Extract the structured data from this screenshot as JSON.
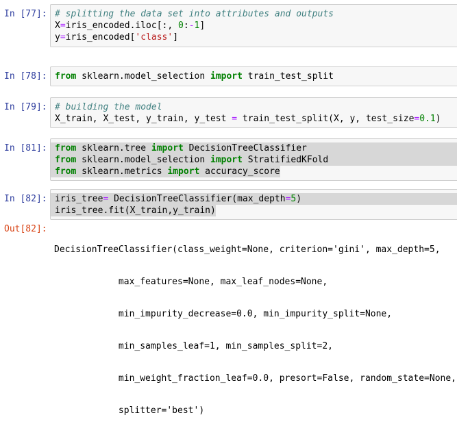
{
  "cells": [
    {
      "prompt": "In [77]:",
      "lines": [
        [
          {
            "t": "# splitting the data set into attributes and outputs",
            "c": "comment"
          }
        ],
        [
          {
            "t": "X",
            "c": ""
          },
          {
            "t": "=",
            "c": "op"
          },
          {
            "t": "iris_encoded.iloc[:, ",
            "c": ""
          },
          {
            "t": "0",
            "c": "num"
          },
          {
            "t": ":",
            "c": ""
          },
          {
            "t": "-",
            "c": "op"
          },
          {
            "t": "1",
            "c": "num"
          },
          {
            "t": "]",
            "c": ""
          }
        ],
        [
          {
            "t": "y",
            "c": ""
          },
          {
            "t": "=",
            "c": "op"
          },
          {
            "t": "iris_encoded[",
            "c": ""
          },
          {
            "t": "'class'",
            "c": "str"
          },
          {
            "t": "]",
            "c": ""
          }
        ]
      ]
    },
    {
      "prompt": "In [78]:",
      "lines": [
        [
          {
            "t": "from",
            "c": "kw"
          },
          {
            "t": " sklearn.model_selection ",
            "c": ""
          },
          {
            "t": "import",
            "c": "kw"
          },
          {
            "t": " train_test_split",
            "c": ""
          }
        ]
      ]
    },
    {
      "prompt": "In [79]:",
      "lines": [
        [
          {
            "t": "# building the model",
            "c": "comment"
          }
        ],
        [
          {
            "t": "X_train, X_test, y_train, y_test ",
            "c": ""
          },
          {
            "t": "=",
            "c": "op"
          },
          {
            "t": " train_test_split(X, y, test_size",
            "c": ""
          },
          {
            "t": "=",
            "c": "op"
          },
          {
            "t": "0.1",
            "c": "num"
          },
          {
            "t": ")",
            "c": ""
          }
        ]
      ]
    },
    {
      "prompt": "In [81]:",
      "lines": [
        [
          {
            "t": "from",
            "c": "kw"
          },
          {
            "t": " sklearn.tree ",
            "c": ""
          },
          {
            "t": "import",
            "c": "kw"
          },
          {
            "t": " DecisionTreeClassifier",
            "c": ""
          }
        ],
        [
          {
            "t": "from",
            "c": "kw"
          },
          {
            "t": " sklearn.model_selection ",
            "c": ""
          },
          {
            "t": "import",
            "c": "kw"
          },
          {
            "t": " StratifiedKFold",
            "c": ""
          }
        ],
        [
          {
            "t": "from",
            "c": "kw"
          },
          {
            "t": " sklearn.metrics ",
            "c": ""
          },
          {
            "t": "import",
            "c": "kw"
          },
          {
            "t": " accuracy_score",
            "c": ""
          }
        ]
      ]
    },
    {
      "prompt": "In [82]:",
      "lines": [
        [
          {
            "t": "iris_tree",
            "c": ""
          },
          {
            "t": "=",
            "c": "op"
          },
          {
            "t": " DecisionTreeClassifier(max_depth",
            "c": ""
          },
          {
            "t": "=",
            "c": "op"
          },
          {
            "t": "5",
            "c": "num"
          },
          {
            "t": ")",
            "c": ""
          }
        ],
        [
          {
            "t": "iris_tree.fit(X_train,y_train)",
            "c": ""
          }
        ]
      ]
    }
  ],
  "output": {
    "prompt": "Out[82]:",
    "lines": [
      "DecisionTreeClassifier(class_weight=None, criterion='gini', max_depth=5,",
      "            max_features=None, max_leaf_nodes=None,",
      "            min_impurity_decrease=0.0, min_impurity_split=None,",
      "            min_samples_leaf=1, min_samples_split=2,",
      "            min_weight_fraction_leaf=0.0, presort=False, random_state=None,",
      "            splitter='best')"
    ]
  },
  "colors": {
    "in_prompt": "#303f9f",
    "out_prompt": "#d84315",
    "cell_bg": "#f7f7f7",
    "cell_border": "#cfcfcf",
    "selection": "#d7d7d7",
    "keyword": "#008000",
    "comment": "#408080",
    "string": "#ba2121",
    "operator": "#aa22ff"
  }
}
